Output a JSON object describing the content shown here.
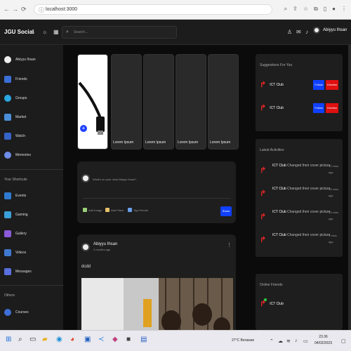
{
  "browser": {
    "url": "localhost:3000"
  },
  "header": {
    "logo": "JGU Social",
    "search_placeholder": "Search...",
    "user_name": "Abiyyu Ihsan"
  },
  "sidebar": {
    "items": [
      {
        "label": "Abiyyu Ihsan"
      },
      {
        "label": "Friends"
      },
      {
        "label": "Groups"
      },
      {
        "label": "Market"
      },
      {
        "label": "Watch"
      },
      {
        "label": "Memories"
      }
    ],
    "shortcuts_title": "Your Shortcuts",
    "shortcuts": [
      {
        "label": "Events"
      },
      {
        "label": "Gaming"
      },
      {
        "label": "Gallery"
      },
      {
        "label": "Videos"
      },
      {
        "label": "Messages"
      }
    ],
    "others_title": "Others",
    "others": [
      {
        "label": "Courses"
      }
    ]
  },
  "stories": [
    {
      "label": "Lorem Ipsum"
    },
    {
      "label": "Lorem Ipsum"
    },
    {
      "label": "Lorem Ipsum"
    },
    {
      "label": "Lorem Ipsum"
    }
  ],
  "create_post": {
    "placeholder": "What's on your mind Abiyyu Ihsan?",
    "add_image": "Add Image",
    "add_place": "Add Place",
    "tag_friends": "Tag Friends",
    "share": "Share"
  },
  "post": {
    "author": "Abiyyu Ihsan",
    "time": "2 months ago",
    "text": "dcdd"
  },
  "suggestions": {
    "title": "Suggestions For You",
    "items": [
      {
        "name": "ICT Club",
        "follow": "Follow",
        "dismiss": "Dismiss"
      },
      {
        "name": "ICT Club",
        "follow": "Follow",
        "dismiss": "Dismiss"
      }
    ]
  },
  "activities": {
    "title": "Latest Activities",
    "items": [
      {
        "who": "ICT Club",
        "what": "Changed their cover picture",
        "when": "12 mins ago"
      },
      {
        "who": "ICT Club",
        "what": "Changed their cover picture",
        "when": "13 mins ago"
      },
      {
        "who": "ICT Club",
        "what": "Changed their cover picture",
        "when": "12 mins ago"
      },
      {
        "who": "ICT Club",
        "what": "Changed their cover picture",
        "when": "1 mins ago"
      }
    ]
  },
  "online": {
    "title": "Online Friends",
    "items": [
      {
        "name": "ICT Club"
      }
    ]
  },
  "taskbar": {
    "weather": "27°C Berawan",
    "time": "23.36",
    "date": "04/02/2023"
  },
  "colors": {
    "accent_blue": "#1040ff",
    "dismiss_red": "#e01010",
    "brand_red": "#e02424"
  }
}
